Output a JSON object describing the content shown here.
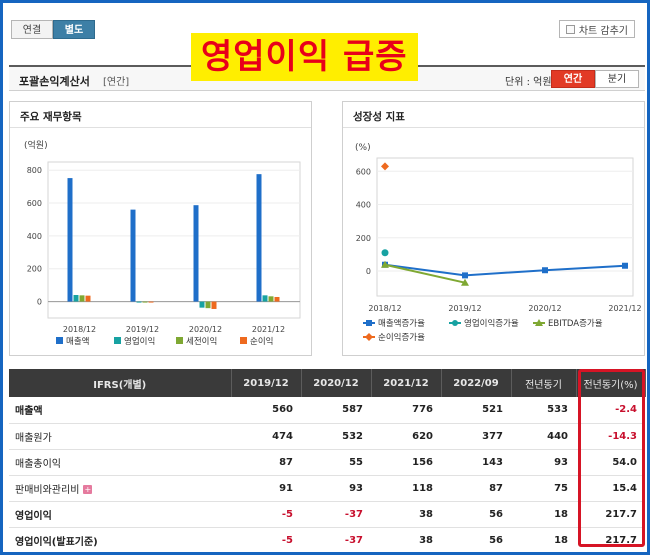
{
  "top_tabs": [
    {
      "label": "연결",
      "active": false
    },
    {
      "label": "별도",
      "active": true
    }
  ],
  "chart_toggle_label": "차트 감추기",
  "headline": "영업이익 급증",
  "section": {
    "title": "포괄손익계산서",
    "subtitle": "[연간]",
    "unit": "단위 : 억원",
    "periods": [
      {
        "label": "연간",
        "active": true
      },
      {
        "label": "분기",
        "active": false
      }
    ]
  },
  "left_panel": {
    "title": "주요 재무항목"
  },
  "right_panel": {
    "title": "성장성 지표"
  },
  "colors": {
    "sales": "#1f6fc9",
    "op_income": "#17a2a2",
    "pretax": "#7fa833",
    "net": "#ee6a1f"
  },
  "chart_data": [
    {
      "type": "bar",
      "ylabel": "(억원)",
      "categories": [
        "2018/12",
        "2019/12",
        "2020/12",
        "2021/12"
      ],
      "ylim": [
        -100,
        850
      ],
      "yticks": [
        0,
        200,
        400,
        600,
        800
      ],
      "series": [
        {
          "name": "매출액",
          "values": [
            752,
            560,
            587,
            776
          ]
        },
        {
          "name": "영업이익",
          "values": [
            40,
            -5,
            -37,
            38
          ]
        },
        {
          "name": "세전이익",
          "values": [
            38,
            -4,
            -40,
            32
          ]
        },
        {
          "name": "순이익",
          "values": [
            36,
            -6,
            -45,
            28
          ]
        }
      ],
      "legend_position": "bottom"
    },
    {
      "type": "line",
      "ylabel": "(%)",
      "categories": [
        "2018/12",
        "2019/12",
        "2020/12",
        "2021/12"
      ],
      "ylim": [
        -150,
        680
      ],
      "yticks": [
        0,
        200,
        400,
        600
      ],
      "series": [
        {
          "name": "매출액증가율",
          "values": [
            38,
            -26,
            5,
            32
          ]
        },
        {
          "name": "영업이익증가율",
          "values": [
            110,
            null,
            null,
            null
          ]
        },
        {
          "name": "EBITDA증가율",
          "values": [
            38,
            -70,
            null,
            null
          ]
        },
        {
          "name": "순이익증가율",
          "values": [
            630,
            null,
            null,
            null
          ]
        }
      ],
      "legend_position": "bottom"
    }
  ],
  "table": {
    "header": [
      "IFRS(개별)",
      "2019/12",
      "2020/12",
      "2021/12",
      "2022/09",
      "전년동기",
      "전년동기(%)"
    ],
    "rows": [
      {
        "label": "매출액",
        "values": [
          "560",
          "587",
          "776",
          "521",
          "533",
          "-2.4"
        ],
        "strong": true
      },
      {
        "label": "매출원가",
        "values": [
          "474",
          "532",
          "620",
          "377",
          "440",
          "-14.3"
        ],
        "strong": false
      },
      {
        "label": "매출총이익",
        "values": [
          "87",
          "55",
          "156",
          "143",
          "93",
          "54.0"
        ],
        "strong": false
      },
      {
        "label": "판매비와관리비",
        "values": [
          "91",
          "93",
          "118",
          "87",
          "75",
          "15.4"
        ],
        "strong": false,
        "expand": true
      },
      {
        "label": "영업이익",
        "values": [
          "-5",
          "-37",
          "38",
          "56",
          "18",
          "217.7"
        ],
        "strong": true
      },
      {
        "label": "영업이익(발표기준)",
        "values": [
          "-5",
          "-37",
          "38",
          "56",
          "18",
          "217.7"
        ],
        "strong": true
      }
    ]
  }
}
